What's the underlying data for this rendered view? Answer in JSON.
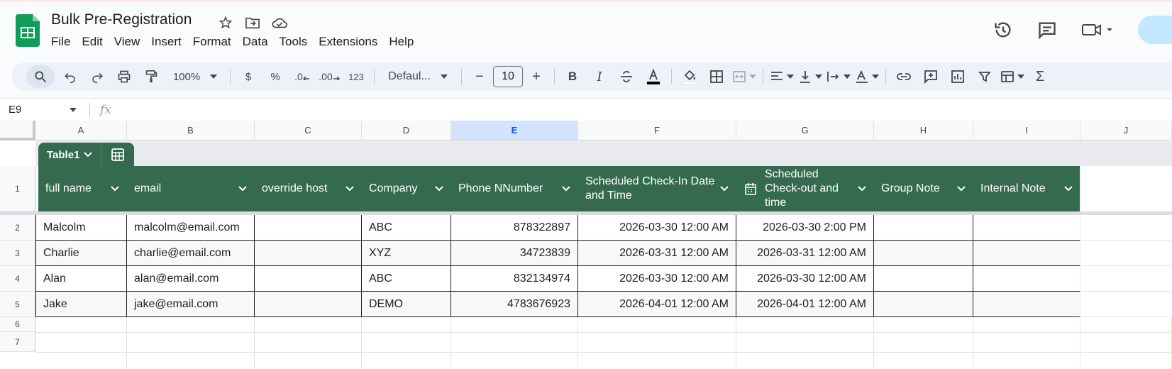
{
  "app": {
    "title": "Bulk Pre-Registration"
  },
  "menu": [
    "File",
    "Edit",
    "View",
    "Insert",
    "Format",
    "Data",
    "Tools",
    "Extensions",
    "Help"
  ],
  "toolbar": {
    "zoom": "100%",
    "currency": "$",
    "percent": "%",
    "dec_decrease": ".0",
    "dec_increase": ".00",
    "number_format": "123",
    "font": "Defaul...",
    "font_size": "10",
    "minus": "−",
    "plus": "+",
    "bold": "B",
    "italic": "I"
  },
  "formula_bar": {
    "cell_ref": "E9",
    "fx": "fx",
    "value": ""
  },
  "columns": [
    "A",
    "B",
    "C",
    "D",
    "E",
    "F",
    "G",
    "H",
    "I",
    "J"
  ],
  "selected_column": "E",
  "table": {
    "name": "Table1",
    "headers": [
      "full name",
      "email",
      "override host",
      "Company",
      "Phone NNumber",
      "Scheduled Check-In Date and Time",
      "Scheduled Check-out and time",
      "Group Note",
      "Internal Note"
    ],
    "rows": [
      [
        "Malcolm",
        "malcolm@email.com",
        "",
        "ABC",
        "878322897",
        "2026-03-30 12:00 AM",
        "2026-03-30 2:00 PM",
        "",
        ""
      ],
      [
        "Charlie",
        "charlie@email.com",
        "",
        "XYZ",
        "34723839",
        "2026-03-31 12:00 AM",
        "2026-03-31 12:00 AM",
        "",
        ""
      ],
      [
        "Alan",
        "alan@email.com",
        "",
        "ABC",
        "832134974",
        "2026-03-30 12:00 AM",
        "2026-03-30 12:00 AM",
        "",
        ""
      ],
      [
        "Jake",
        "jake@email.com",
        "",
        "DEMO",
        "4783676923",
        "2026-04-01 12:00 AM",
        "2026-04-01 12:00 AM",
        "",
        ""
      ]
    ]
  },
  "row_numbers": [
    "1",
    "2",
    "3",
    "4",
    "5",
    "6",
    "7"
  ],
  "colors": {
    "table_header": "#356a4f",
    "selected_col": "#d3e3fd",
    "sheets_green": "#0f9d58"
  }
}
